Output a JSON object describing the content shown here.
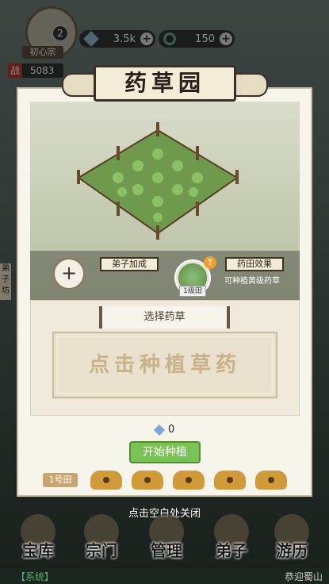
{
  "hud": {
    "level": "2",
    "rank": "初心宗",
    "power_tag": "战",
    "power_value": "5083",
    "gems": "3.5k",
    "jade": "150"
  },
  "panel": {
    "title": "药草园",
    "add_symbol": "+",
    "disciple_bonus": "弟子加成",
    "plot_label": "1级田",
    "field_effect": "药田效果",
    "field_effect_desc": "可种植黄级药草",
    "select_title": "选择药草",
    "select_prompt": "点击种植草药",
    "cost_value": "0",
    "start_button": "开始种植",
    "plot1_label": "1号田"
  },
  "close_hint": "点击空白处关闭",
  "side_tag": "弟子坊",
  "nav": [
    {
      "label": "宝库"
    },
    {
      "label": "宗门"
    },
    {
      "label": "管理"
    },
    {
      "label": "弟子"
    },
    {
      "label": "游历"
    }
  ],
  "footer": {
    "system": "【系统】",
    "welcome": "恭迎蜀山"
  }
}
